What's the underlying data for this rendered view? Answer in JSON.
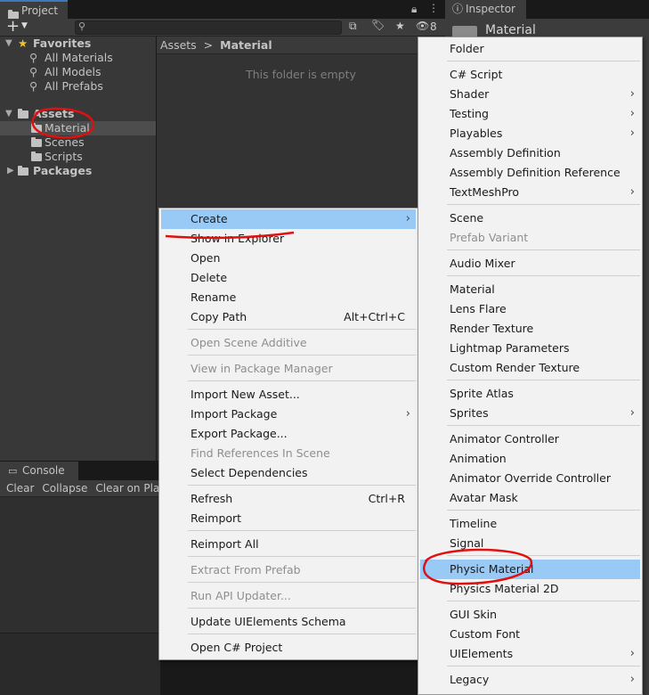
{
  "project_tab": {
    "label": "Project"
  },
  "inspector_tab": {
    "label": "Inspector"
  },
  "inspector": {
    "title": "Material"
  },
  "project_toolbar": {
    "add_label": "+",
    "hidden_count": "8"
  },
  "tree": {
    "favorites": "Favorites",
    "fav_items": [
      "All Materials",
      "All Models",
      "All Prefabs"
    ],
    "assets": "Assets",
    "asset_items": [
      "Material",
      "Scenes",
      "Scripts"
    ],
    "packages": "Packages"
  },
  "breadcrumb": {
    "root": "Assets",
    "separator": ">",
    "current": "Material"
  },
  "empty_message": "This folder is empty",
  "console": {
    "tab": "Console",
    "buttons": [
      "Clear",
      "Collapse",
      "Clear on Play"
    ]
  },
  "context_menu": {
    "items": [
      {
        "label": "Create",
        "submenu": true,
        "highlighted": true
      },
      {
        "label": "Show in Explorer"
      },
      {
        "label": "Open"
      },
      {
        "label": "Delete"
      },
      {
        "label": "Rename"
      },
      {
        "label": "Copy Path",
        "shortcut": "Alt+Ctrl+C"
      },
      {
        "label": "Open Scene Additive",
        "disabled": true
      },
      {
        "label": "View in Package Manager",
        "disabled": true
      },
      {
        "label": "Import New Asset..."
      },
      {
        "label": "Import Package",
        "submenu": true
      },
      {
        "label": "Export Package..."
      },
      {
        "label": "Find References In Scene",
        "disabled": true
      },
      {
        "label": "Select Dependencies"
      },
      {
        "label": "Refresh",
        "shortcut": "Ctrl+R"
      },
      {
        "label": "Reimport"
      },
      {
        "label": "Reimport All"
      },
      {
        "label": "Extract From Prefab",
        "disabled": true
      },
      {
        "label": "Run API Updater...",
        "disabled": true
      },
      {
        "label": "Update UIElements Schema"
      },
      {
        "label": "Open C# Project"
      }
    ]
  },
  "create_menu": {
    "items": [
      {
        "label": "Folder"
      },
      {
        "label": "C# Script"
      },
      {
        "label": "Shader",
        "submenu": true
      },
      {
        "label": "Testing",
        "submenu": true
      },
      {
        "label": "Playables",
        "submenu": true
      },
      {
        "label": "Assembly Definition"
      },
      {
        "label": "Assembly Definition Reference"
      },
      {
        "label": "TextMeshPro",
        "submenu": true
      },
      {
        "label": "Scene"
      },
      {
        "label": "Prefab Variant",
        "disabled": true
      },
      {
        "label": "Audio Mixer"
      },
      {
        "label": "Material"
      },
      {
        "label": "Lens Flare"
      },
      {
        "label": "Render Texture"
      },
      {
        "label": "Lightmap Parameters"
      },
      {
        "label": "Custom Render Texture"
      },
      {
        "label": "Sprite Atlas"
      },
      {
        "label": "Sprites",
        "submenu": true
      },
      {
        "label": "Animator Controller"
      },
      {
        "label": "Animation"
      },
      {
        "label": "Animator Override Controller"
      },
      {
        "label": "Avatar Mask"
      },
      {
        "label": "Timeline"
      },
      {
        "label": "Signal"
      },
      {
        "label": "Physic Material",
        "highlighted": true
      },
      {
        "label": "Physics Material 2D"
      },
      {
        "label": "GUI Skin"
      },
      {
        "label": "Custom Font"
      },
      {
        "label": "UIElements",
        "submenu": true
      },
      {
        "label": "Legacy",
        "submenu": true
      }
    ]
  },
  "annotation_color": "#e01010"
}
